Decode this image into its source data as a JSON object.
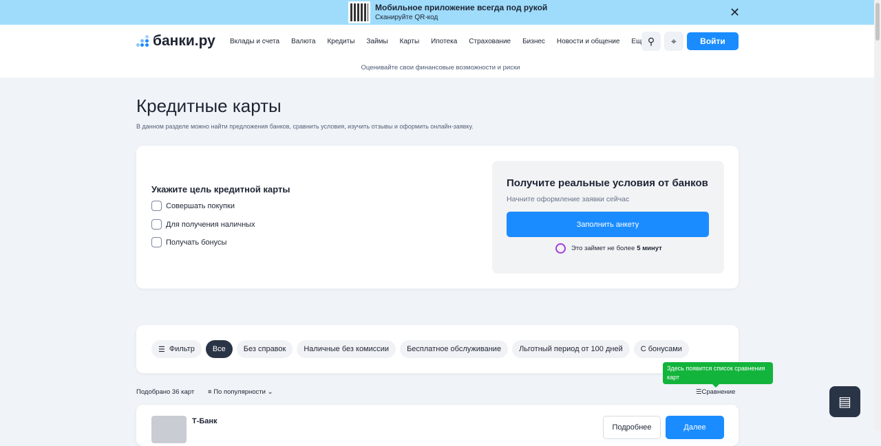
{
  "banner": {
    "title": "Мобильное приложение всегда под рукой",
    "subtitle": "Сканируйте QR-код",
    "close": "✕"
  },
  "header": {
    "logo": "банки.ру",
    "nav": [
      "Вклады и счета",
      "Валюта",
      "Кредиты",
      "Займы",
      "Карты",
      "Ипотека",
      "Страхование",
      "Бизнес",
      "Новости и общение",
      "Еще"
    ],
    "login": "Войти",
    "subline": "Оценивайте свои финансовые возможности и риски"
  },
  "page": {
    "title": "Кредитные карты",
    "description": "В данном разделе можно найти предложения банков, сравнить условия, изучить отзывы и оформить онлайн-заявку."
  },
  "goal": {
    "title": "Укажите цель кредитной карты",
    "options": [
      "Совершать покупки",
      "Для получения наличных",
      "Получать бонусы"
    ]
  },
  "promo": {
    "title": "Получите реальные условия от банков",
    "subtitle": "Начните оформление заявки сейчас",
    "button": "Заполнить анкету",
    "note": "Это займет не более",
    "note_bold": "5 минут"
  },
  "filters": {
    "filter": "Фильтр",
    "chips": [
      "Все",
      "Без справок",
      "Наличные без комиссии",
      "Бесплатное обслуживание",
      "Льготный период от 100 дней",
      "С бонусами"
    ]
  },
  "tooltip": "Здесь появится список сравнения карт",
  "results": {
    "count": "Подобрано 36 карт",
    "sort": "По популярности",
    "compare": "Сравнение"
  },
  "bank": {
    "name": "Т-Банк",
    "details": "Подробнее",
    "next": "Далее"
  }
}
